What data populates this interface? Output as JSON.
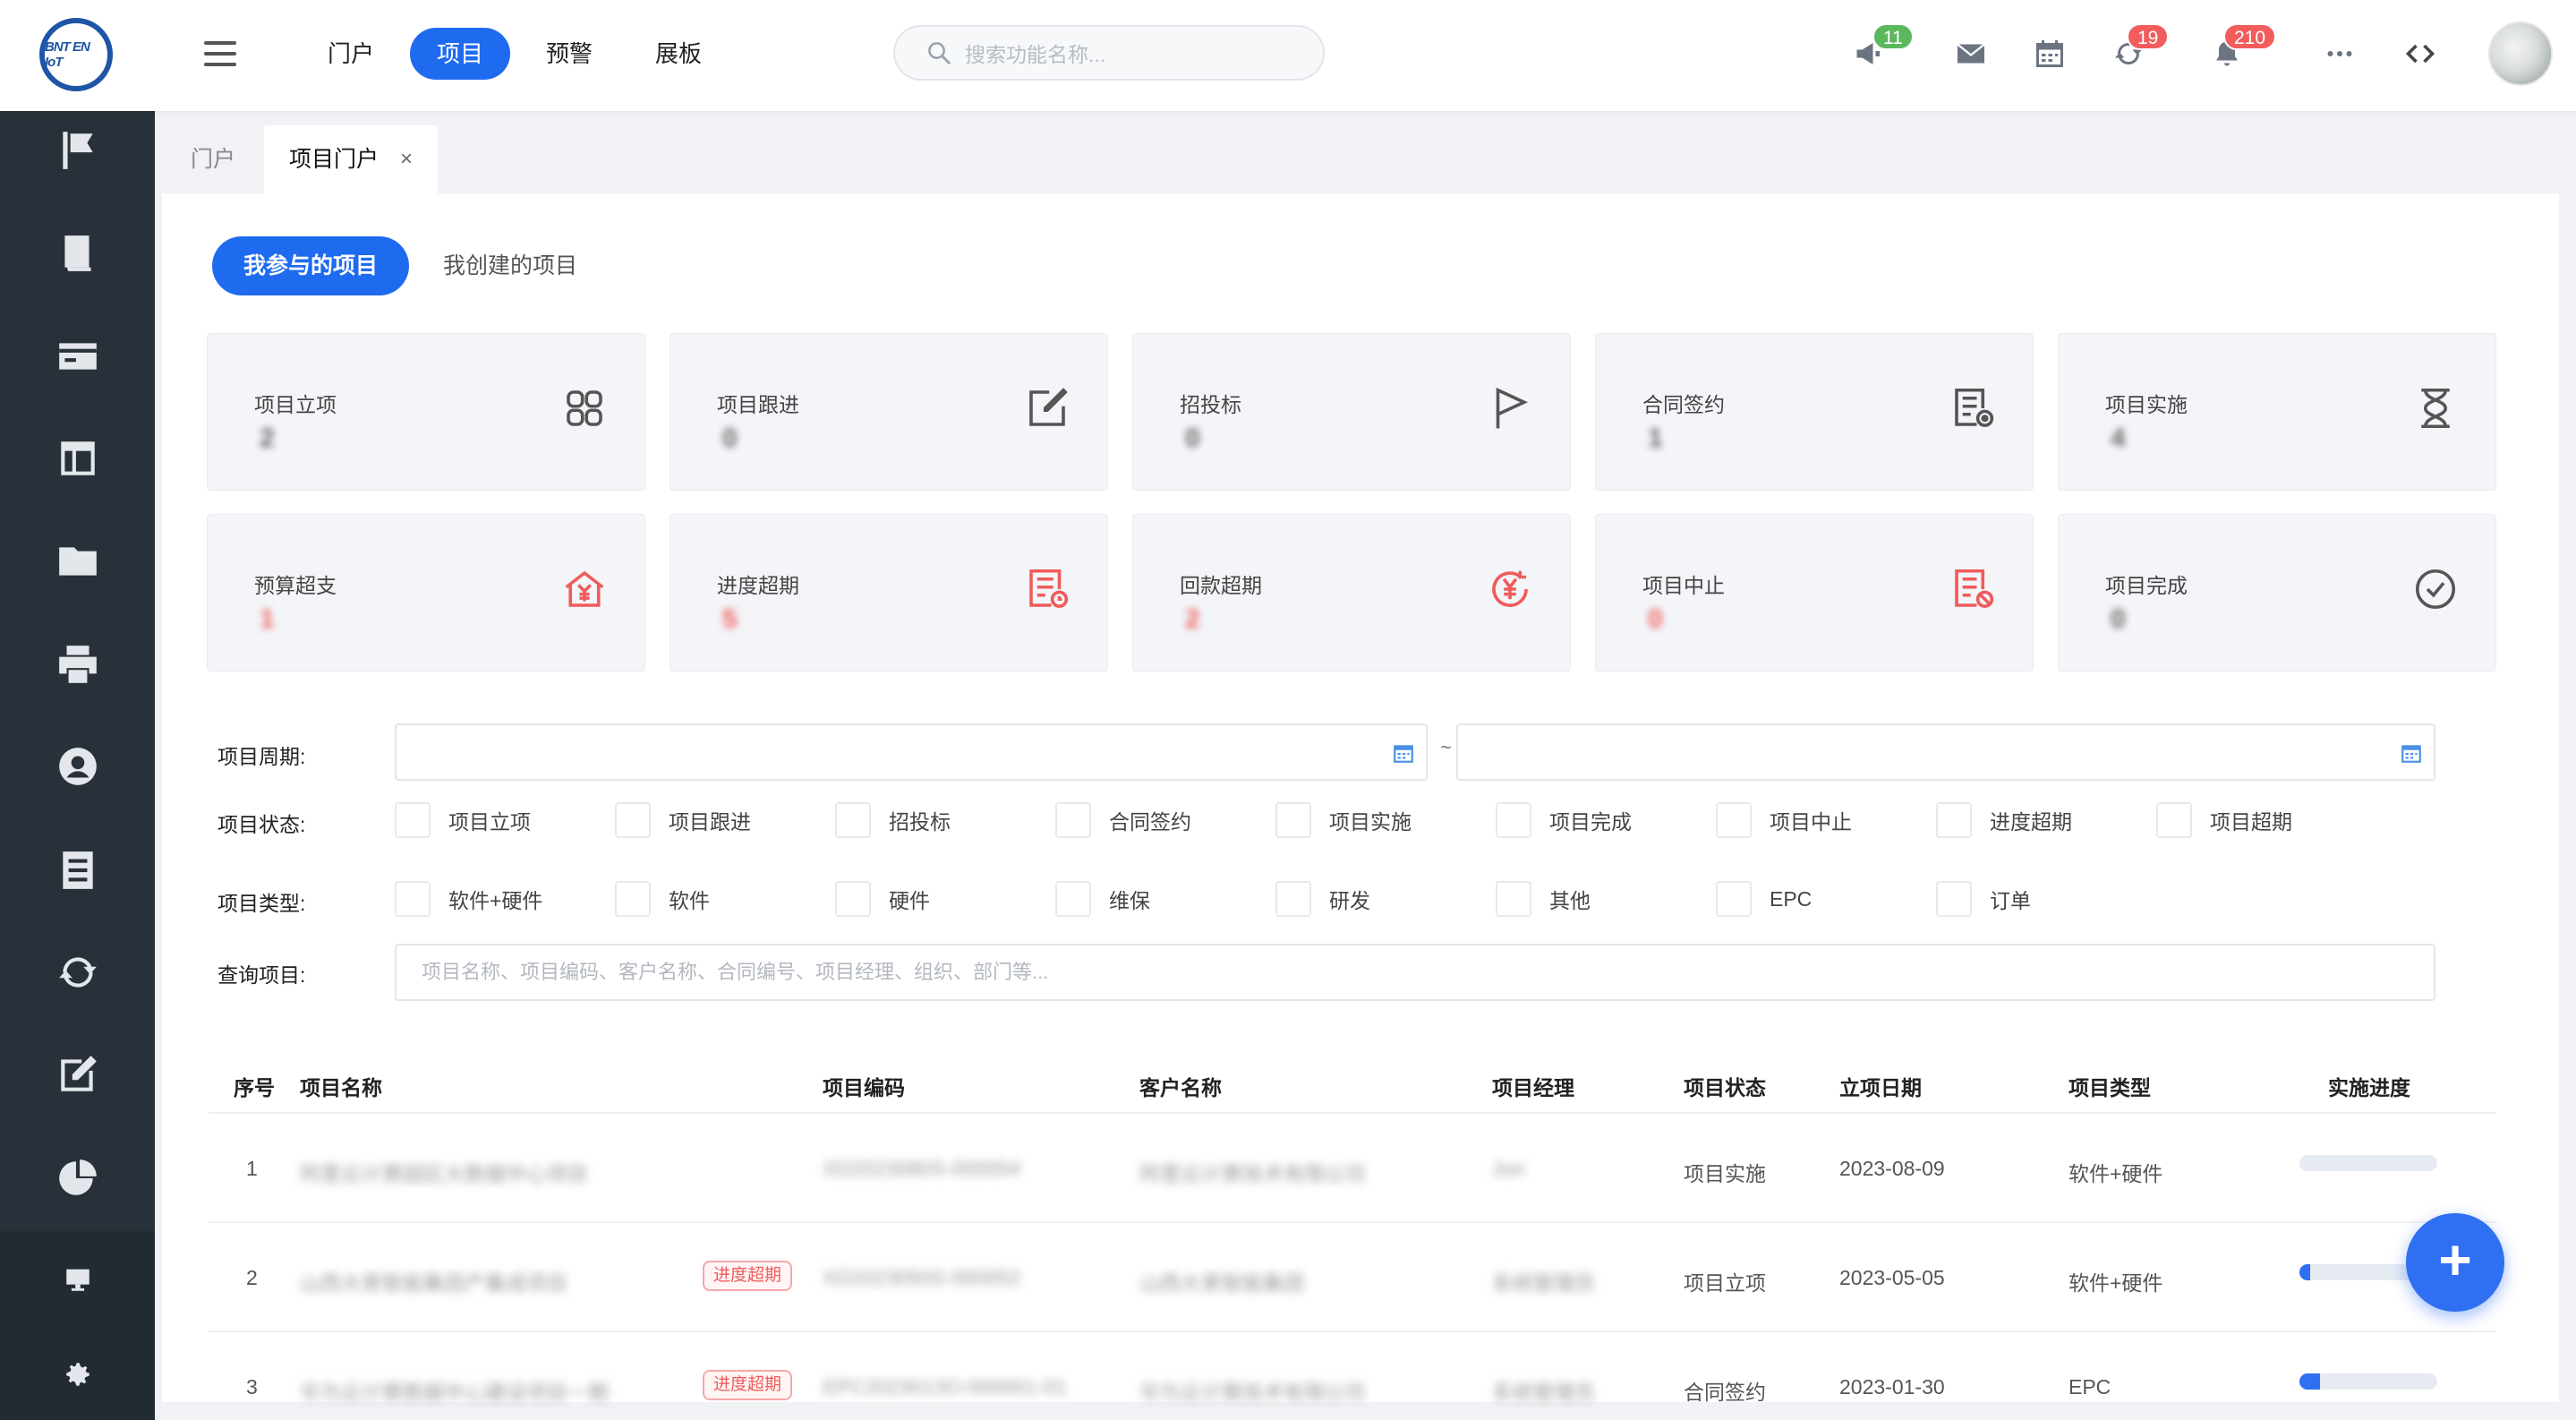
{
  "app": {
    "logo_text": "BNT EN IoT"
  },
  "header": {
    "nav": [
      "门户",
      "项目",
      "预警",
      "展板"
    ],
    "active_nav": "项目",
    "search_placeholder": "搜索功能名称...",
    "badges": {
      "announcements": "11",
      "sync": "19",
      "notifications": "210"
    }
  },
  "tabs": {
    "home": "门户",
    "current": "项目门户",
    "close": "×"
  },
  "segments": {
    "mine": "我参与的项目",
    "created": "我创建的项目"
  },
  "stats": [
    {
      "label": "项目立项",
      "value": "2",
      "icon": "grid-icon",
      "danger": false
    },
    {
      "label": "项目跟进",
      "value": "0",
      "icon": "edit-icon",
      "danger": false
    },
    {
      "label": "招投标",
      "value": "0",
      "icon": "flag-icon",
      "danger": false
    },
    {
      "label": "合同签约",
      "value": "1",
      "icon": "contract-icon",
      "danger": false
    },
    {
      "label": "项目实施",
      "value": "4",
      "icon": "hourglass-icon",
      "danger": false
    },
    {
      "label": "预算超支",
      "value": "1",
      "icon": "budget-icon",
      "danger": true
    },
    {
      "label": "进度超期",
      "value": "5",
      "icon": "schedule-icon",
      "danger": true
    },
    {
      "label": "回款超期",
      "value": "2",
      "icon": "yen-icon",
      "danger": true
    },
    {
      "label": "项目中止",
      "value": "0",
      "icon": "stop-icon",
      "danger": true
    },
    {
      "label": "项目完成",
      "value": "0",
      "icon": "check-circle-icon",
      "danger": false
    }
  ],
  "filters": {
    "period_label": "项目周期:",
    "tilde": "~",
    "status_label": "项目状态:",
    "status_options": [
      "项目立项",
      "项目跟进",
      "招投标",
      "合同签约",
      "项目实施",
      "项目完成",
      "项目中止",
      "进度超期",
      "项目超期"
    ],
    "type_label": "项目类型:",
    "type_options": [
      "软件+硬件",
      "软件",
      "硬件",
      "维保",
      "研发",
      "其他",
      "EPC",
      "订单"
    ],
    "query_label": "查询项目:",
    "query_placeholder": "项目名称、项目编码、客户名称、合同编号、项目经理、组织、部门等..."
  },
  "table": {
    "headers": [
      "序号",
      "项目名称",
      "项目编码",
      "客户名称",
      "项目经理",
      "项目状态",
      "立项日期",
      "项目类型",
      "实施进度"
    ],
    "rows": [
      {
        "no": "1",
        "name": "阿里云计算园区大数据中心项目",
        "tag": "",
        "code": "XD2023080S-000054",
        "customer": "阿里云计算技术有限公司",
        "manager": "Jun",
        "status": "项目实施",
        "date": "2023-08-09",
        "type": "软件+硬件",
        "progress": 0
      },
      {
        "no": "2",
        "name": "山西大景智能集团产集成项目",
        "tag": "进度超期",
        "code": "XD2023050S-000052",
        "customer": "山西大景智能集团",
        "manager": "系统管理员",
        "status": "项目立项",
        "date": "2023-05-05",
        "type": "软件+硬件",
        "progress": 8
      },
      {
        "no": "3",
        "name": "华为云计算数据中心建设项目一期",
        "tag": "进度超期",
        "code": "EPC2023013O-000001-01",
        "customer": "华为云计算技术有限公司",
        "manager": "系统管理员",
        "status": "合同签约",
        "date": "2023-01-30",
        "type": "EPC",
        "progress": 15
      }
    ]
  },
  "fab": "+"
}
